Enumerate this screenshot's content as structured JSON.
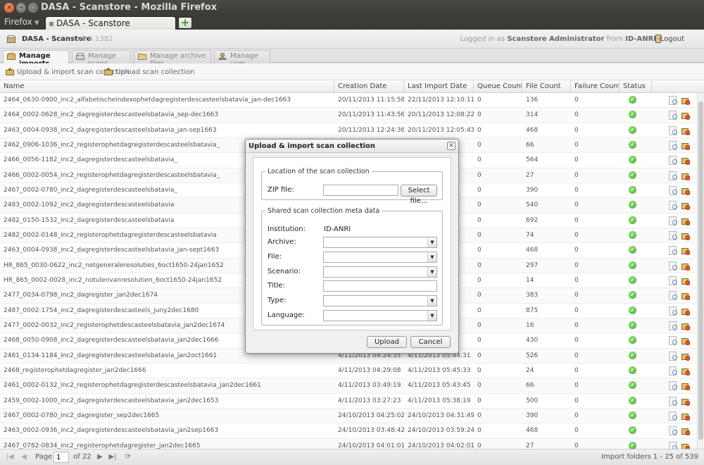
{
  "window": {
    "title": "DASA - Scanstore - Mozilla Firefox"
  },
  "browser": {
    "menu_label": "Firefox",
    "tab_title": "DASA - Scanstore",
    "new_tab_symbol": "+"
  },
  "app": {
    "name": "DASA - Scanstore",
    "version": "v2.0.1382",
    "login_prefix": "Logged in as",
    "user": "Scanstore Administrator",
    "login_from": "from",
    "institution": "ID-ANRI",
    "logout_label": "Logout"
  },
  "tabs": [
    {
      "label": "Manage imports",
      "icon": "box-icon",
      "active": true
    },
    {
      "label": "Manage scans",
      "icon": "scanner-icon",
      "active": false
    },
    {
      "label": "Manage archive files",
      "icon": "folder-icon",
      "active": false
    },
    {
      "label": "Manage user",
      "icon": "user-icon",
      "active": false
    }
  ],
  "toolbar": {
    "upload_import_label": "Upload & import scan collection",
    "upload_label": "Upload scan collection"
  },
  "grid": {
    "columns": [
      "Name",
      "Creation Date",
      "Last Import Date",
      "Queue Count",
      "File Count",
      "Failure Count",
      "Status"
    ],
    "rows": [
      {
        "name": "2464_0630-0900_inc2_alfabetischeindexophetdagregisterdescasteelsbatavia_jan-dec1663",
        "created": "20/11/2013 11:15:58",
        "imported": "22/11/2013 12:10:11",
        "queue": "0",
        "files": "136",
        "failures": "0"
      },
      {
        "name": "2464_0002-0628_inc2_dagregisterdescasteelsbatavia_sep-dec1663",
        "created": "20/11/2013 11:43:56",
        "imported": "20/11/2013 12:08:22",
        "queue": "0",
        "files": "314",
        "failures": "0"
      },
      {
        "name": "2463_0004-0938_inc2_dagregisterdescasteelsbatavia_jan-sep1663",
        "created": "20/11/2013 12:24:36",
        "imported": "20/11/2013 12:05:43",
        "queue": "0",
        "files": "468",
        "failures": "0"
      },
      {
        "name": "2462_0906-1036_inc2_registerophetdagregisterdescasteelsbatavia_",
        "created": "",
        "imported": "",
        "queue": "0",
        "files": "66",
        "failures": "0"
      },
      {
        "name": "2466_0056-1182_inc2_dagregisterdescasteelsbatavia_",
        "created": "",
        "imported": "",
        "queue": "0",
        "files": "564",
        "failures": "0"
      },
      {
        "name": "2466_0002-0054_inc2_registerophetdagregisterdescasteelsbatavia_",
        "created": "",
        "imported": "",
        "queue": "0",
        "files": "27",
        "failures": "0"
      },
      {
        "name": "2467_0002-0780_inc2_dagregisterdescasteelsbatavia_",
        "created": "",
        "imported": "",
        "queue": "0",
        "files": "390",
        "failures": "0"
      },
      {
        "name": "2483_0002-1092_inc2_dagregisterdescasteelsbatavia",
        "created": "",
        "imported": "",
        "queue": "0",
        "files": "540",
        "failures": "0"
      },
      {
        "name": "2482_0150-1532_inc2_dagregisterdescasteelsbatavia",
        "created": "",
        "imported": "",
        "queue": "0",
        "files": "692",
        "failures": "0"
      },
      {
        "name": "2482_0002-0148_inc2_registerophetdagregisterdescasteelsbatavia",
        "created": "",
        "imported": "",
        "queue": "0",
        "files": "74",
        "failures": "0"
      },
      {
        "name": "2463_0004-0938_inc2_dagregisterdescasteelsbatavia_jan-sept1663",
        "created": "",
        "imported": "",
        "queue": "0",
        "files": "468",
        "failures": "0"
      },
      {
        "name": "HR_865_0030-0622_inc2_netgeneraleresoluties_6oct1650-24jan1652",
        "created": "",
        "imported": "",
        "queue": "0",
        "files": "297",
        "failures": "0"
      },
      {
        "name": "HR_865_0002-0028_inc2_notulenvanresolutien_6oct1650-24jan1652",
        "created": "",
        "imported": "",
        "queue": "0",
        "files": "14",
        "failures": "0"
      },
      {
        "name": "2477_0034-0798_inc2_dagregister_jan2dec1674",
        "created": "",
        "imported": "",
        "queue": "0",
        "files": "383",
        "failures": "0"
      },
      {
        "name": "2487_0002-1754_inc2_dagregisterdescasteels_juny2dec1680",
        "created": "",
        "imported": "",
        "queue": "0",
        "files": "875",
        "failures": "0"
      },
      {
        "name": "2477_0002-0032_inc2_registerophetdescasteelsbatavia_jan2dec1674",
        "created": "",
        "imported": "",
        "queue": "0",
        "files": "16",
        "failures": "0"
      },
      {
        "name": "2468_0050-0908_inc2_dagregisterdescasteelsbatavia_jan2dec1666",
        "created": "",
        "imported": "",
        "queue": "0",
        "files": "430",
        "failures": "0"
      },
      {
        "name": "2461_0134-1184_inc2_dagregisterdescasteelsbatavia_jan2oct1661",
        "created": "4/11/2013 04:24:35",
        "imported": "4/11/2013 05:44:31",
        "queue": "0",
        "files": "526",
        "failures": "0"
      },
      {
        "name": "2468_registerophetdagregister_jan2dec1666",
        "created": "4/11/2013 04:29:08",
        "imported": "4/11/2013 05:45:33",
        "queue": "0",
        "files": "24",
        "failures": "0"
      },
      {
        "name": "2461_0002-0132_inc2_registerophetdagregisterdescasteelsbatavia_jan2dec1661",
        "created": "4/11/2013 03:49:19",
        "imported": "4/11/2013 05:43:45",
        "queue": "0",
        "files": "66",
        "failures": "0"
      },
      {
        "name": "2459_0002-1000_inc2_dagregisterdescasteelsbatavia_jan2dec1653",
        "created": "4/11/2013 03:27:23",
        "imported": "4/11/2013 05:38:19",
        "queue": "0",
        "files": "500",
        "failures": "0"
      },
      {
        "name": "2467_0002-0780_inc2_dagregister_sep2dec1665",
        "created": "24/10/2013 04:25:02",
        "imported": "24/10/2013 04:31:49",
        "queue": "0",
        "files": "390",
        "failures": "0"
      },
      {
        "name": "2463_0002-0936_inc2_dagregisterdescasteelsbatavia_jan2sep1663",
        "created": "24/10/2013 03:48:42",
        "imported": "24/10/2013 03:59:24",
        "queue": "0",
        "files": "468",
        "failures": "0"
      },
      {
        "name": "2467_0782-0834_inc2_registerophetdagregister_jan2dec1665",
        "created": "24/10/2013 04:01:01",
        "imported": "24/10/2013 04:02:01",
        "queue": "0",
        "files": "27",
        "failures": "0"
      }
    ]
  },
  "pager": {
    "page_label": "Page",
    "current_page": "1",
    "of_label": "of 22",
    "info": "Import folders 1 - 25 of 539"
  },
  "dialog": {
    "title": "Upload & import scan collection",
    "close_symbol": "×",
    "location_legend": "Location of the scan collection",
    "zip_label": "ZIP file:",
    "zip_value": "",
    "select_file_label": "Select file...",
    "meta_legend": "Shared scan collection meta data",
    "institution_label": "Institution:",
    "institution_value": "ID-ANRI",
    "archive_label": "Archive:",
    "file_label": "File:",
    "scenario_label": "Scenario:",
    "title_label": "Title:",
    "type_label": "Type:",
    "language_label": "Language:",
    "upload_label": "Upload",
    "cancel_label": "Cancel"
  },
  "colors": {
    "titlebar": "#3c3b37",
    "close_button": "#e2501c",
    "status_ok": "#3ea826",
    "add_tab": "#3b9b1d"
  }
}
